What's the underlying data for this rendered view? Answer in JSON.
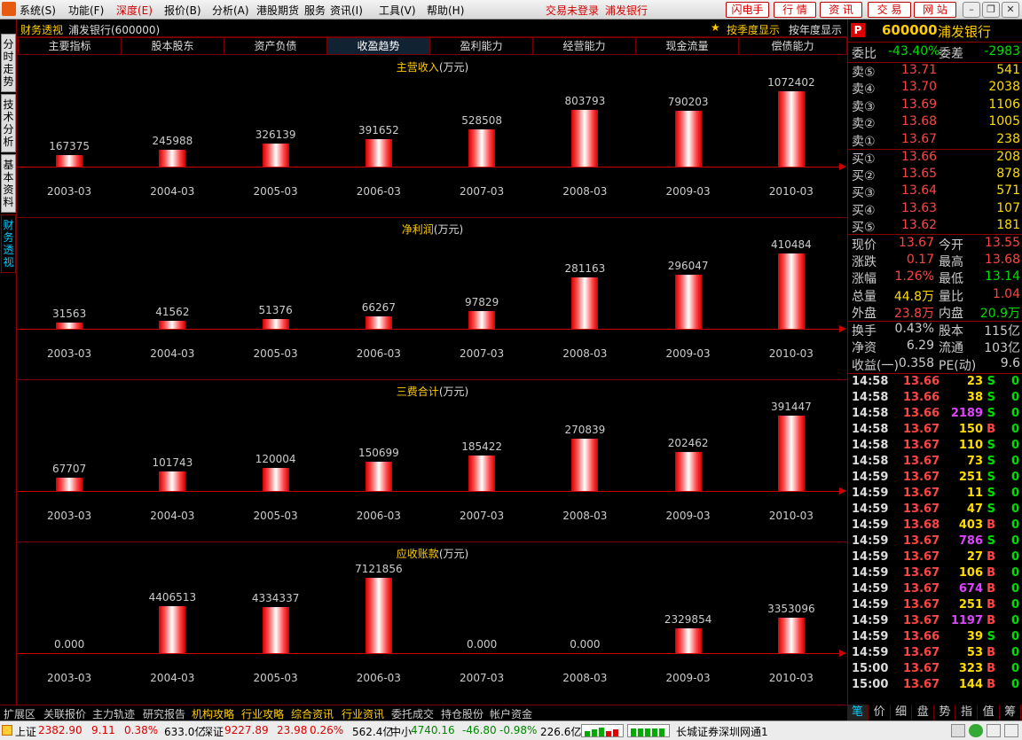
{
  "menu": {
    "items": [
      "系统(S)",
      "功能(F)",
      "深度(E)",
      "报价(B)",
      "分析(A)",
      "港股期货",
      "服务",
      "资讯(I)",
      "工具(V)",
      "帮助(H)"
    ],
    "status": "交易未登录",
    "stock": "浦发银行",
    "buttons": [
      "闪电手",
      "行 情",
      "资 讯",
      "交 易",
      "网 站"
    ]
  },
  "left_tabs": [
    "分时走势",
    "技术分析",
    "基本资料",
    "财务透视"
  ],
  "title": {
    "section": "财务透视",
    "stock": "浦发银行(600000)",
    "season_btn": "按季度显示",
    "year_btn": "按年度显示"
  },
  "tabs": [
    "主要指标",
    "股本股东",
    "资产负债",
    "收盈趋势",
    "盈利能力",
    "经营能力",
    "现金流量",
    "偿债能力"
  ],
  "chart_data": [
    {
      "type": "bar",
      "title": "主营收入",
      "unit": "(万元)",
      "categories": [
        "2003-03",
        "2004-03",
        "2005-03",
        "2006-03",
        "2007-03",
        "2008-03",
        "2009-03",
        "2010-03"
      ],
      "values": [
        167375,
        245988,
        326139,
        391652,
        528508,
        803793,
        790203,
        1072402
      ],
      "labels": [
        "167375",
        "245988",
        "326139",
        "391652",
        "528508",
        "803793",
        "790203",
        "1072402"
      ]
    },
    {
      "type": "bar",
      "title": "净利润",
      "unit": "(万元)",
      "categories": [
        "2003-03",
        "2004-03",
        "2005-03",
        "2006-03",
        "2007-03",
        "2008-03",
        "2009-03",
        "2010-03"
      ],
      "values": [
        31563,
        41562,
        51376,
        66267,
        97829,
        281163,
        296047,
        410484
      ],
      "labels": [
        "31563",
        "41562",
        "51376",
        "66267",
        "97829",
        "281163",
        "296047",
        "410484"
      ]
    },
    {
      "type": "bar",
      "title": "三费合计",
      "unit": "(万元)",
      "categories": [
        "2003-03",
        "2004-03",
        "2005-03",
        "2006-03",
        "2007-03",
        "2008-03",
        "2009-03",
        "2010-03"
      ],
      "values": [
        67707,
        101743,
        120004,
        150699,
        185422,
        270839,
        202462,
        391447
      ],
      "labels": [
        "67707",
        "101743",
        "120004",
        "150699",
        "185422",
        "270839",
        "202462",
        "391447"
      ]
    },
    {
      "type": "bar",
      "title": "应收账款",
      "unit": "(万元)",
      "categories": [
        "2003-03",
        "2004-03",
        "2005-03",
        "2006-03",
        "2007-03",
        "2008-03",
        "2009-03",
        "2010-03"
      ],
      "values": [
        0,
        4406513,
        4334337,
        7121856,
        0,
        0,
        2329854,
        3353096
      ],
      "labels": [
        "0.000",
        "4406513",
        "4334337",
        "7121856",
        "0.000",
        "0.000",
        "2329854",
        "3353096"
      ]
    }
  ],
  "quote": {
    "code": "600000",
    "name": "浦发银行",
    "badge": "P",
    "weibi_label": "委比",
    "weibi": "-43.40%",
    "weicha_label": "委差",
    "weicha": "-2983",
    "sell": [
      {
        "label": "卖⑤",
        "price": "13.71",
        "vol": "541"
      },
      {
        "label": "卖④",
        "price": "13.70",
        "vol": "2038"
      },
      {
        "label": "卖③",
        "price": "13.69",
        "vol": "1106"
      },
      {
        "label": "卖②",
        "price": "13.68",
        "vol": "1005"
      },
      {
        "label": "卖①",
        "price": "13.67",
        "vol": "238"
      }
    ],
    "buy": [
      {
        "label": "买①",
        "price": "13.66",
        "vol": "208"
      },
      {
        "label": "买②",
        "price": "13.65",
        "vol": "878"
      },
      {
        "label": "买③",
        "price": "13.64",
        "vol": "571"
      },
      {
        "label": "买④",
        "price": "13.63",
        "vol": "107"
      },
      {
        "label": "买⑤",
        "price": "13.62",
        "vol": "181"
      }
    ],
    "stats": [
      [
        "现价",
        "13.67",
        "今开",
        "13.55"
      ],
      [
        "涨跌",
        "0.17",
        "最高",
        "13.68"
      ],
      [
        "涨幅",
        "1.26%",
        "最低",
        "13.14"
      ],
      [
        "总量",
        "44.8万",
        "量比",
        "1.04"
      ],
      [
        "外盘",
        "23.8万",
        "内盘",
        "20.9万"
      ]
    ],
    "stats2": [
      [
        "换手",
        "0.43%",
        "股本",
        "115亿"
      ],
      [
        "净资",
        "6.29",
        "流通",
        "103亿"
      ],
      [
        "收益(一)",
        "0.358",
        "PE(动)",
        "9.6"
      ]
    ]
  },
  "ticks": [
    [
      "14:58",
      "13.66",
      "23",
      "S"
    ],
    [
      "14:58",
      "13.66",
      "38",
      "S"
    ],
    [
      "14:58",
      "13.66",
      "2189",
      "S"
    ],
    [
      "14:58",
      "13.67",
      "150",
      "B"
    ],
    [
      "14:58",
      "13.67",
      "110",
      "S"
    ],
    [
      "14:58",
      "13.67",
      "73",
      "S"
    ],
    [
      "14:59",
      "13.67",
      "251",
      "S"
    ],
    [
      "14:59",
      "13.67",
      "11",
      "S"
    ],
    [
      "14:59",
      "13.67",
      "47",
      "S"
    ],
    [
      "14:59",
      "13.68",
      "403",
      "B"
    ],
    [
      "14:59",
      "13.67",
      "786",
      "S"
    ],
    [
      "14:59",
      "13.67",
      "27",
      "B"
    ],
    [
      "14:59",
      "13.67",
      "106",
      "B"
    ],
    [
      "14:59",
      "13.67",
      "674",
      "B"
    ],
    [
      "14:59",
      "13.67",
      "251",
      "B"
    ],
    [
      "14:59",
      "13.67",
      "1197",
      "B"
    ],
    [
      "14:59",
      "13.66",
      "39",
      "S"
    ],
    [
      "14:59",
      "13.67",
      "53",
      "B"
    ],
    [
      "15:00",
      "13.67",
      "323",
      "B"
    ],
    [
      "15:00",
      "13.67",
      "144",
      "B"
    ]
  ],
  "bottom_tabs": [
    "扩展区",
    "关联报价",
    "主力轨迹",
    "研究报告",
    "机构攻略",
    "行业攻略",
    "综合资讯",
    "行业资讯",
    "委托成交",
    "持仓股份",
    "帐户资金"
  ],
  "right_tabs": [
    "笔",
    "价",
    "细",
    "盘",
    "势",
    "指",
    "值",
    "筹"
  ],
  "status": {
    "sh_label": "上证",
    "sh": "2382.90",
    "sh_chg": "9.11",
    "sh_pct": "0.38%",
    "sh_amt": "633.0亿",
    "sz_label": "深证",
    "sz": "9227.89",
    "sz_chg": "23.98",
    "sz_pct": "0.26%",
    "sz_amt": "562.4亿",
    "zx_label": "中小",
    "zx": "4740.16",
    "zx_chg": "-46.80",
    "zx_pct": "-0.98%",
    "zx_amt": "226.6亿",
    "broker": "长城证券深圳网通1"
  },
  "colors": {
    "up": "#ff4444",
    "down": "#00dd00",
    "vol": "#ffdd00",
    "big": "#dd44ff"
  }
}
